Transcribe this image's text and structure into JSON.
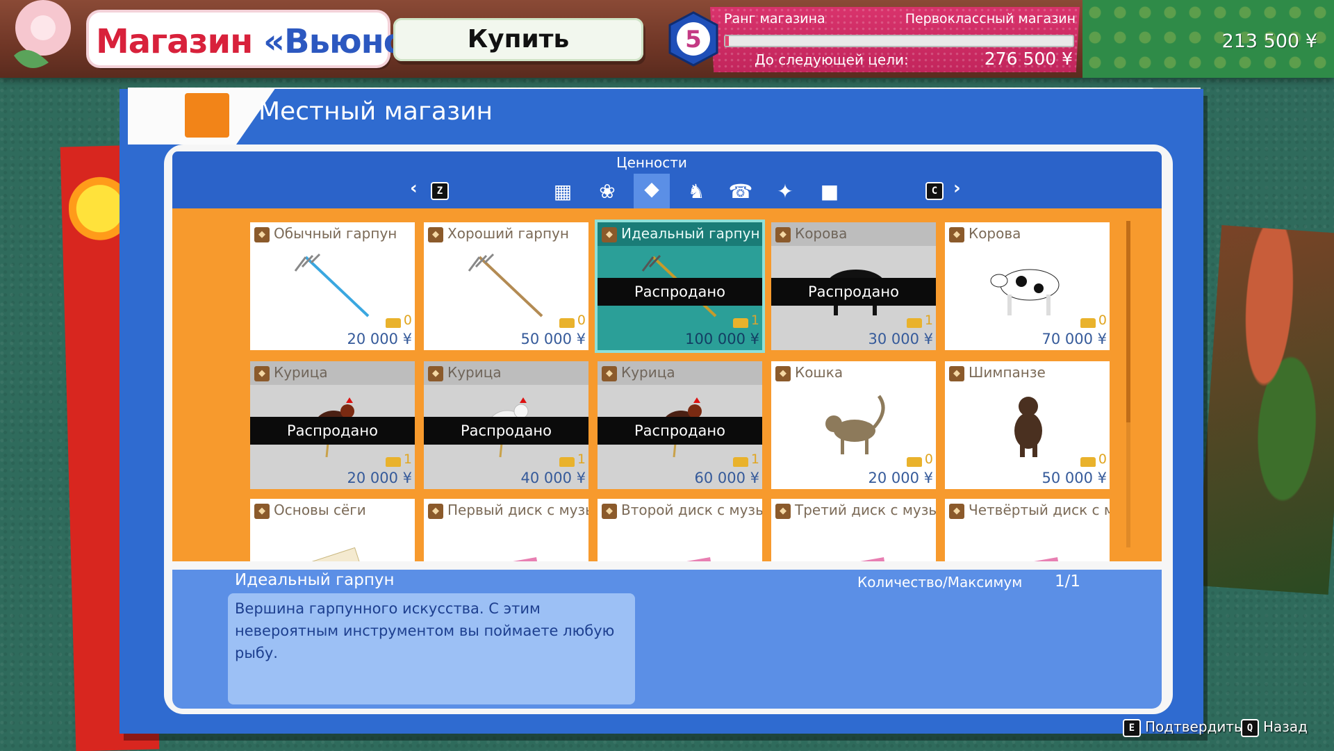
{
  "header": {
    "shop_name_part1": "Магазин",
    "shop_name_part2": "«Вьюнок»",
    "mode": "Купить"
  },
  "rank": {
    "level": "5",
    "label": "Ранг магазина",
    "status": "Первоклассный магазин",
    "progress_fraction": 0.01,
    "next_goal_label": "До следующей цели:",
    "next_goal_value": "276 500 ¥"
  },
  "money": "213 500 ¥",
  "window": {
    "title": "Местный магазин"
  },
  "categories": {
    "current_label": "Ценности",
    "prev_key": "Z",
    "next_key": "C",
    "icons": [
      "grid-icon",
      "flower-icon",
      "diamond-icon",
      "dragon-icon",
      "phone-icon",
      "phone-sparkle-icon",
      "box-icon"
    ],
    "active_index": 2
  },
  "items": [
    {
      "name": "Обычный гарпун",
      "owned": "0",
      "price": "20 000 ¥",
      "status": "available",
      "image": "harpoon-basic"
    },
    {
      "name": "Хороший гарпун",
      "owned": "0",
      "price": "50 000 ¥",
      "status": "available",
      "image": "harpoon-good"
    },
    {
      "name": "Идеальный гарпун",
      "owned": "1",
      "price": "100 000 ¥",
      "status": "sold_out",
      "selected": true,
      "image": "harpoon-perfect"
    },
    {
      "name": "Корова",
      "owned": "1",
      "price": "30 000 ¥",
      "status": "sold_out",
      "image": "cow-black"
    },
    {
      "name": "Корова",
      "owned": "0",
      "price": "70 000 ¥",
      "status": "available",
      "image": "cow-spotted"
    },
    {
      "name": "Курица",
      "owned": "1",
      "price": "20 000 ¥",
      "status": "sold_out",
      "image": "chicken-red"
    },
    {
      "name": "Курица",
      "owned": "1",
      "price": "40 000 ¥",
      "status": "sold_out",
      "image": "chicken-white"
    },
    {
      "name": "Курица",
      "owned": "1",
      "price": "60 000 ¥",
      "status": "sold_out",
      "image": "chicken-red-2"
    },
    {
      "name": "Кошка",
      "owned": "0",
      "price": "20 000 ¥",
      "status": "available",
      "image": "cat"
    },
    {
      "name": "Шимпанзе",
      "owned": "0",
      "price": "50 000 ¥",
      "status": "available",
      "image": "chimp"
    },
    {
      "name": "Основы сёги",
      "image": "shogi-book"
    },
    {
      "name": "Первый диск с музыкой",
      "image": "music-disc"
    },
    {
      "name": "Второй диск с музыкой",
      "image": "music-disc"
    },
    {
      "name": "Третий диск с музыкой",
      "image": "music-disc"
    },
    {
      "name": "Четвёртый диск с музыкой",
      "image": "music-disc"
    }
  ],
  "sold_out_label": "Распродано",
  "description": {
    "title": "Идеальный гарпун",
    "text": "Вершина гарпунного искусства. С этим невероятным инструментом вы поймаете любую рыбу.",
    "quantity_label": "Количество/Максимум",
    "quantity_value": "1/1"
  },
  "hints": {
    "confirm_key": "E",
    "confirm_label": "Подтвердить",
    "back_key": "Q",
    "back_label": "Назад"
  }
}
